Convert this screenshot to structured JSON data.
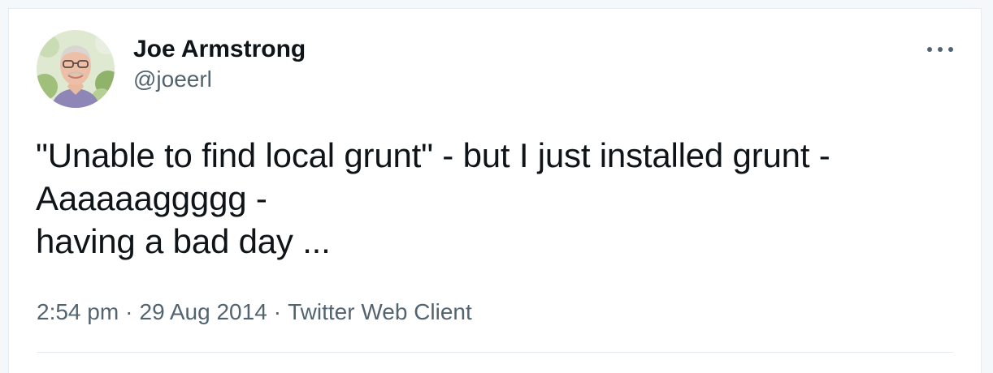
{
  "tweet": {
    "author": {
      "display_name": "Joe Armstrong",
      "handle": "@joeerl"
    },
    "text_lines": [
      "\"Unable to find local grunt\" - but I just installed grunt -",
      "Aaaaaaggggg -",
      "having a bad day ..."
    ],
    "meta": {
      "time": "2:54 pm",
      "separator": "·",
      "date": "29 Aug 2014",
      "source": "Twitter Web Client"
    },
    "icons": {
      "more": "more-horizontal-icon"
    }
  }
}
